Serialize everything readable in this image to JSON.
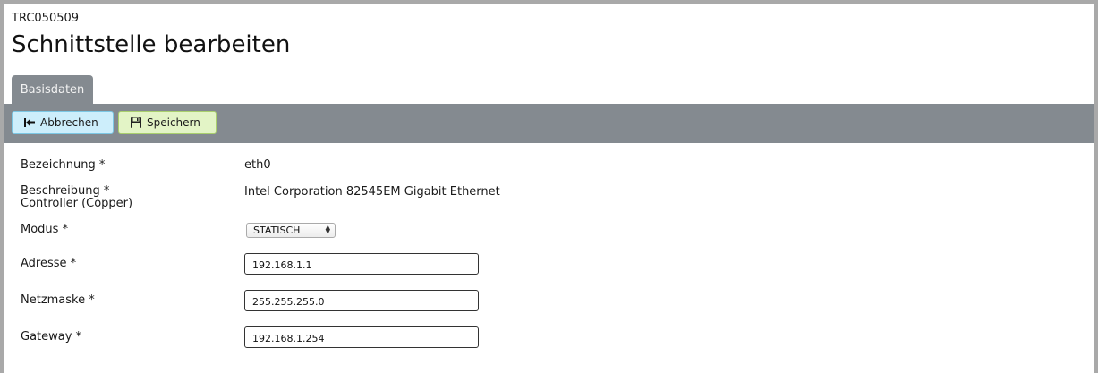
{
  "header": {
    "system_id": "TRC050509",
    "title": "Schnittstelle bearbeiten"
  },
  "tabs": [
    {
      "label": "Basisdaten",
      "active": true
    }
  ],
  "toolbar": {
    "cancel_label": "Abbrechen",
    "cancel_icon": "back-to-start-icon",
    "save_label": "Speichern",
    "save_icon": "floppy-disk-icon"
  },
  "form": {
    "name_label": "Bezeichnung *",
    "name_value": "eth0",
    "description_label_line1": "Beschreibung *",
    "description_label_line2": "Controller (Copper)",
    "description_value": "Intel Corporation 82545EM Gigabit Ethernet",
    "mode_label": "Modus *",
    "mode_value": "STATISCH",
    "address_label": "Adresse *",
    "address_value": "192.168.1.1",
    "netmask_label": "Netzmaske *",
    "netmask_value": "255.255.255.0",
    "gateway_label": "Gateway *",
    "gateway_value": "192.168.1.254"
  },
  "colors": {
    "toolbar_bg": "#848a90",
    "cancel_bg": "#cdeefb",
    "save_bg": "#e3f4c6"
  }
}
